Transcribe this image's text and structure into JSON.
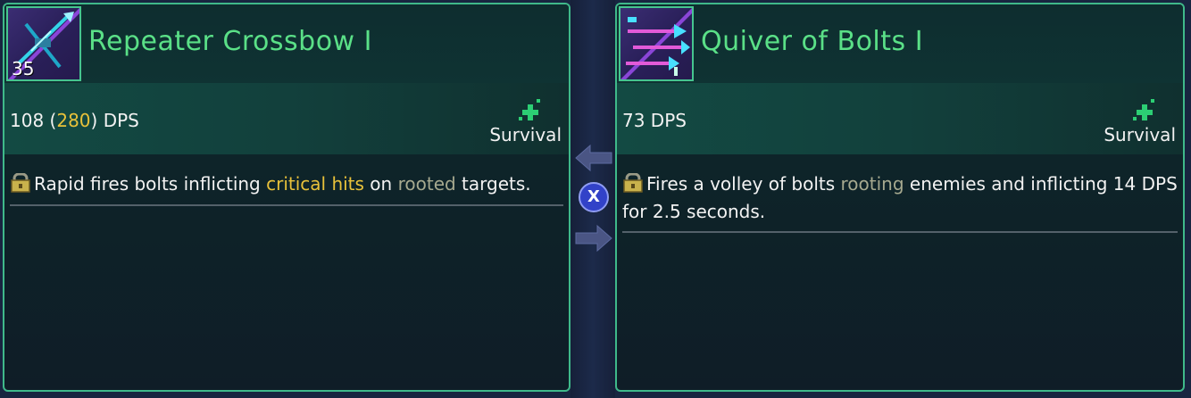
{
  "left_card": {
    "title": "Repeater Crossbow I",
    "level": "35",
    "icon": "crossbow-icon",
    "dps_base": "108",
    "dps_crit": "280",
    "dps_unit": "DPS",
    "attribute": "Survival",
    "attribute_icon": "survival-cross-icon",
    "description": {
      "part1": "Rapid fires bolts inflicting ",
      "highlight1": "critical hits",
      "part2": " on ",
      "highlight2": "rooted",
      "part3": " targets."
    }
  },
  "right_card": {
    "title": "Quiver of Bolts I",
    "icon": "quiver-bolts-icon",
    "dps_text": "73 DPS",
    "attribute": "Survival",
    "attribute_icon": "survival-cross-icon",
    "description": {
      "part1": "Fires a volley of bolts ",
      "highlight1": "rooting",
      "part2": " enemies and inflicting 14 DPS for 2.5 seconds."
    }
  },
  "swap_button_key": "X",
  "colors": {
    "title_green": "#5ae087",
    "border_green": "#3fb98a",
    "crit_gold": "#e8c13a",
    "status_gray": "#a6a98f",
    "swap_blue": "#3242c8"
  }
}
